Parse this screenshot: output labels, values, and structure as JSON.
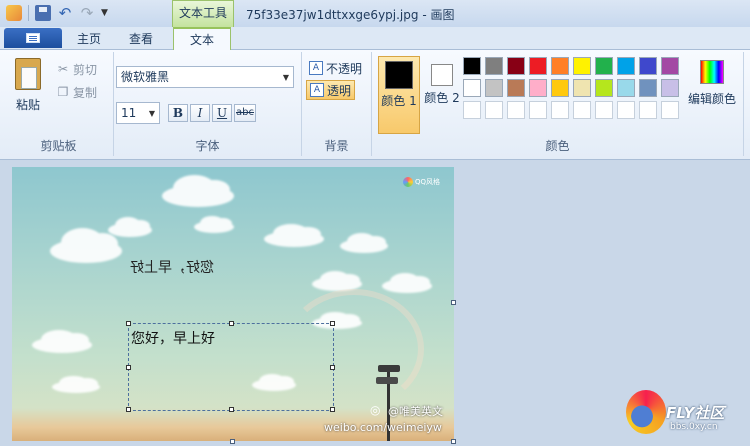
{
  "window": {
    "title": "75f33e37jw1dttxxge6ypj.jpg - 画图",
    "context_tab_group": "文本工具"
  },
  "tabs": [
    {
      "label": "主页"
    },
    {
      "label": "查看"
    },
    {
      "label": "文本",
      "active": true
    }
  ],
  "ribbon": {
    "clipboard": {
      "group_label": "剪贴板",
      "paste_label": "粘贴",
      "cut_label": "剪切",
      "copy_label": "复制"
    },
    "font": {
      "group_label": "字体",
      "font_name": "微软雅黑",
      "font_size": "11",
      "bold": "B",
      "italic": "I",
      "underline": "U",
      "strike": "abc"
    },
    "background": {
      "group_label": "背景",
      "opaque_label": "不透明",
      "transparent_label": "透明",
      "selected": "transparent"
    },
    "colors": {
      "group_label": "颜色",
      "color1_label": "颜色 1",
      "color1_value": "#000000",
      "color2_label": "颜色 2",
      "color2_value": "#ffffff",
      "edit_colors_label": "编辑颜色",
      "palette": [
        "#000000",
        "#7f7f7f",
        "#880015",
        "#ed1c24",
        "#ff7f27",
        "#fff200",
        "#22b14c",
        "#00a2e8",
        "#3f48cc",
        "#a349a4",
        "#ffffff",
        "#c3c3c3",
        "#b97a57",
        "#ffaec9",
        "#ffc90e",
        "#efe4b0",
        "#b5e61d",
        "#99d9ea",
        "#7092be",
        "#c8bfe7",
        "#ffffff",
        "#ffffff",
        "#ffffff",
        "#ffffff",
        "#ffffff",
        "#ffffff",
        "#ffffff",
        "#ffffff",
        "#ffffff",
        "#ffffff"
      ]
    }
  },
  "canvas": {
    "mirrored_text": "您好，早上好",
    "textbox_text": "您好，早上好",
    "watermark_logo": "QQ风格",
    "weibo_name": "@唯美英文",
    "weibo_url": "weibo.com/weimeiyw"
  },
  "site_logo": {
    "title": "FLY社区",
    "url": "bbs.0xy.cn"
  }
}
